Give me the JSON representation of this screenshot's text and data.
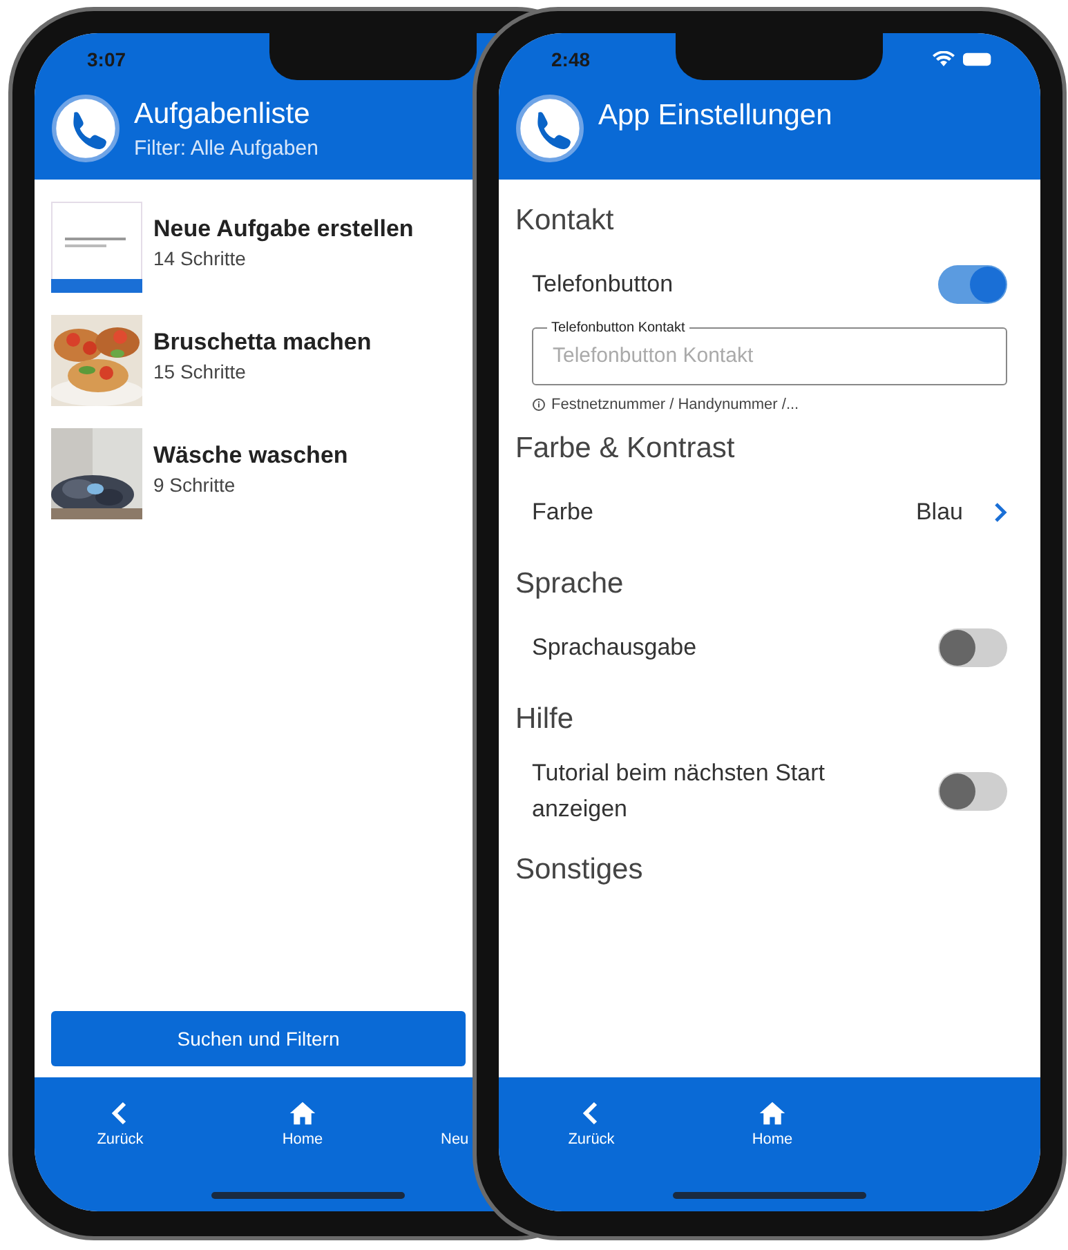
{
  "left_phone": {
    "status_time": "3:07",
    "header": {
      "title": "Aufgabenliste",
      "subtitle": "Filter: Alle Aufgaben"
    },
    "tasks": [
      {
        "title": "Neue Aufgabe erstellen",
        "steps": "14 Schritte",
        "kind": "document"
      },
      {
        "title": "Bruschetta machen",
        "steps": "15 Schritte",
        "kind": "picture"
      },
      {
        "title": "Wäsche waschen",
        "steps": "9 Schritte",
        "kind": "picture"
      }
    ],
    "button": "Suchen und Filtern",
    "tabs": [
      {
        "label": "Zurück"
      },
      {
        "label": "Home"
      },
      {
        "label": "Neu"
      }
    ]
  },
  "right_phone": {
    "status_time": "2:48",
    "header": {
      "title": "App Einstellungen"
    },
    "sections": [
      {
        "title": "Kontakt",
        "rows": [
          {
            "kind": "toggle",
            "label": "Telefonbutton",
            "on": true
          },
          {
            "kind": "field",
            "legend": "Telefonbutton Kontakt",
            "placeholder": "Telefonbutton Kontakt",
            "hint": "Festnetznummer / Handynummer /..."
          }
        ]
      },
      {
        "title": "Farbe & Kontrast",
        "rows": [
          {
            "kind": "select",
            "label": "Farbe",
            "value": "Blau"
          }
        ]
      },
      {
        "title": "Sprache",
        "rows": [
          {
            "kind": "toggle",
            "label": "Sprachausgabe",
            "on": false
          }
        ]
      },
      {
        "title": "Hilfe",
        "rows": [
          {
            "kind": "toggle",
            "label": "Tutorial beim nächsten Start anzeigen",
            "on": false
          }
        ]
      },
      {
        "title": "Sonstiges"
      }
    ],
    "tabs": [
      {
        "label": "Zurück"
      },
      {
        "label": "Home"
      }
    ]
  }
}
